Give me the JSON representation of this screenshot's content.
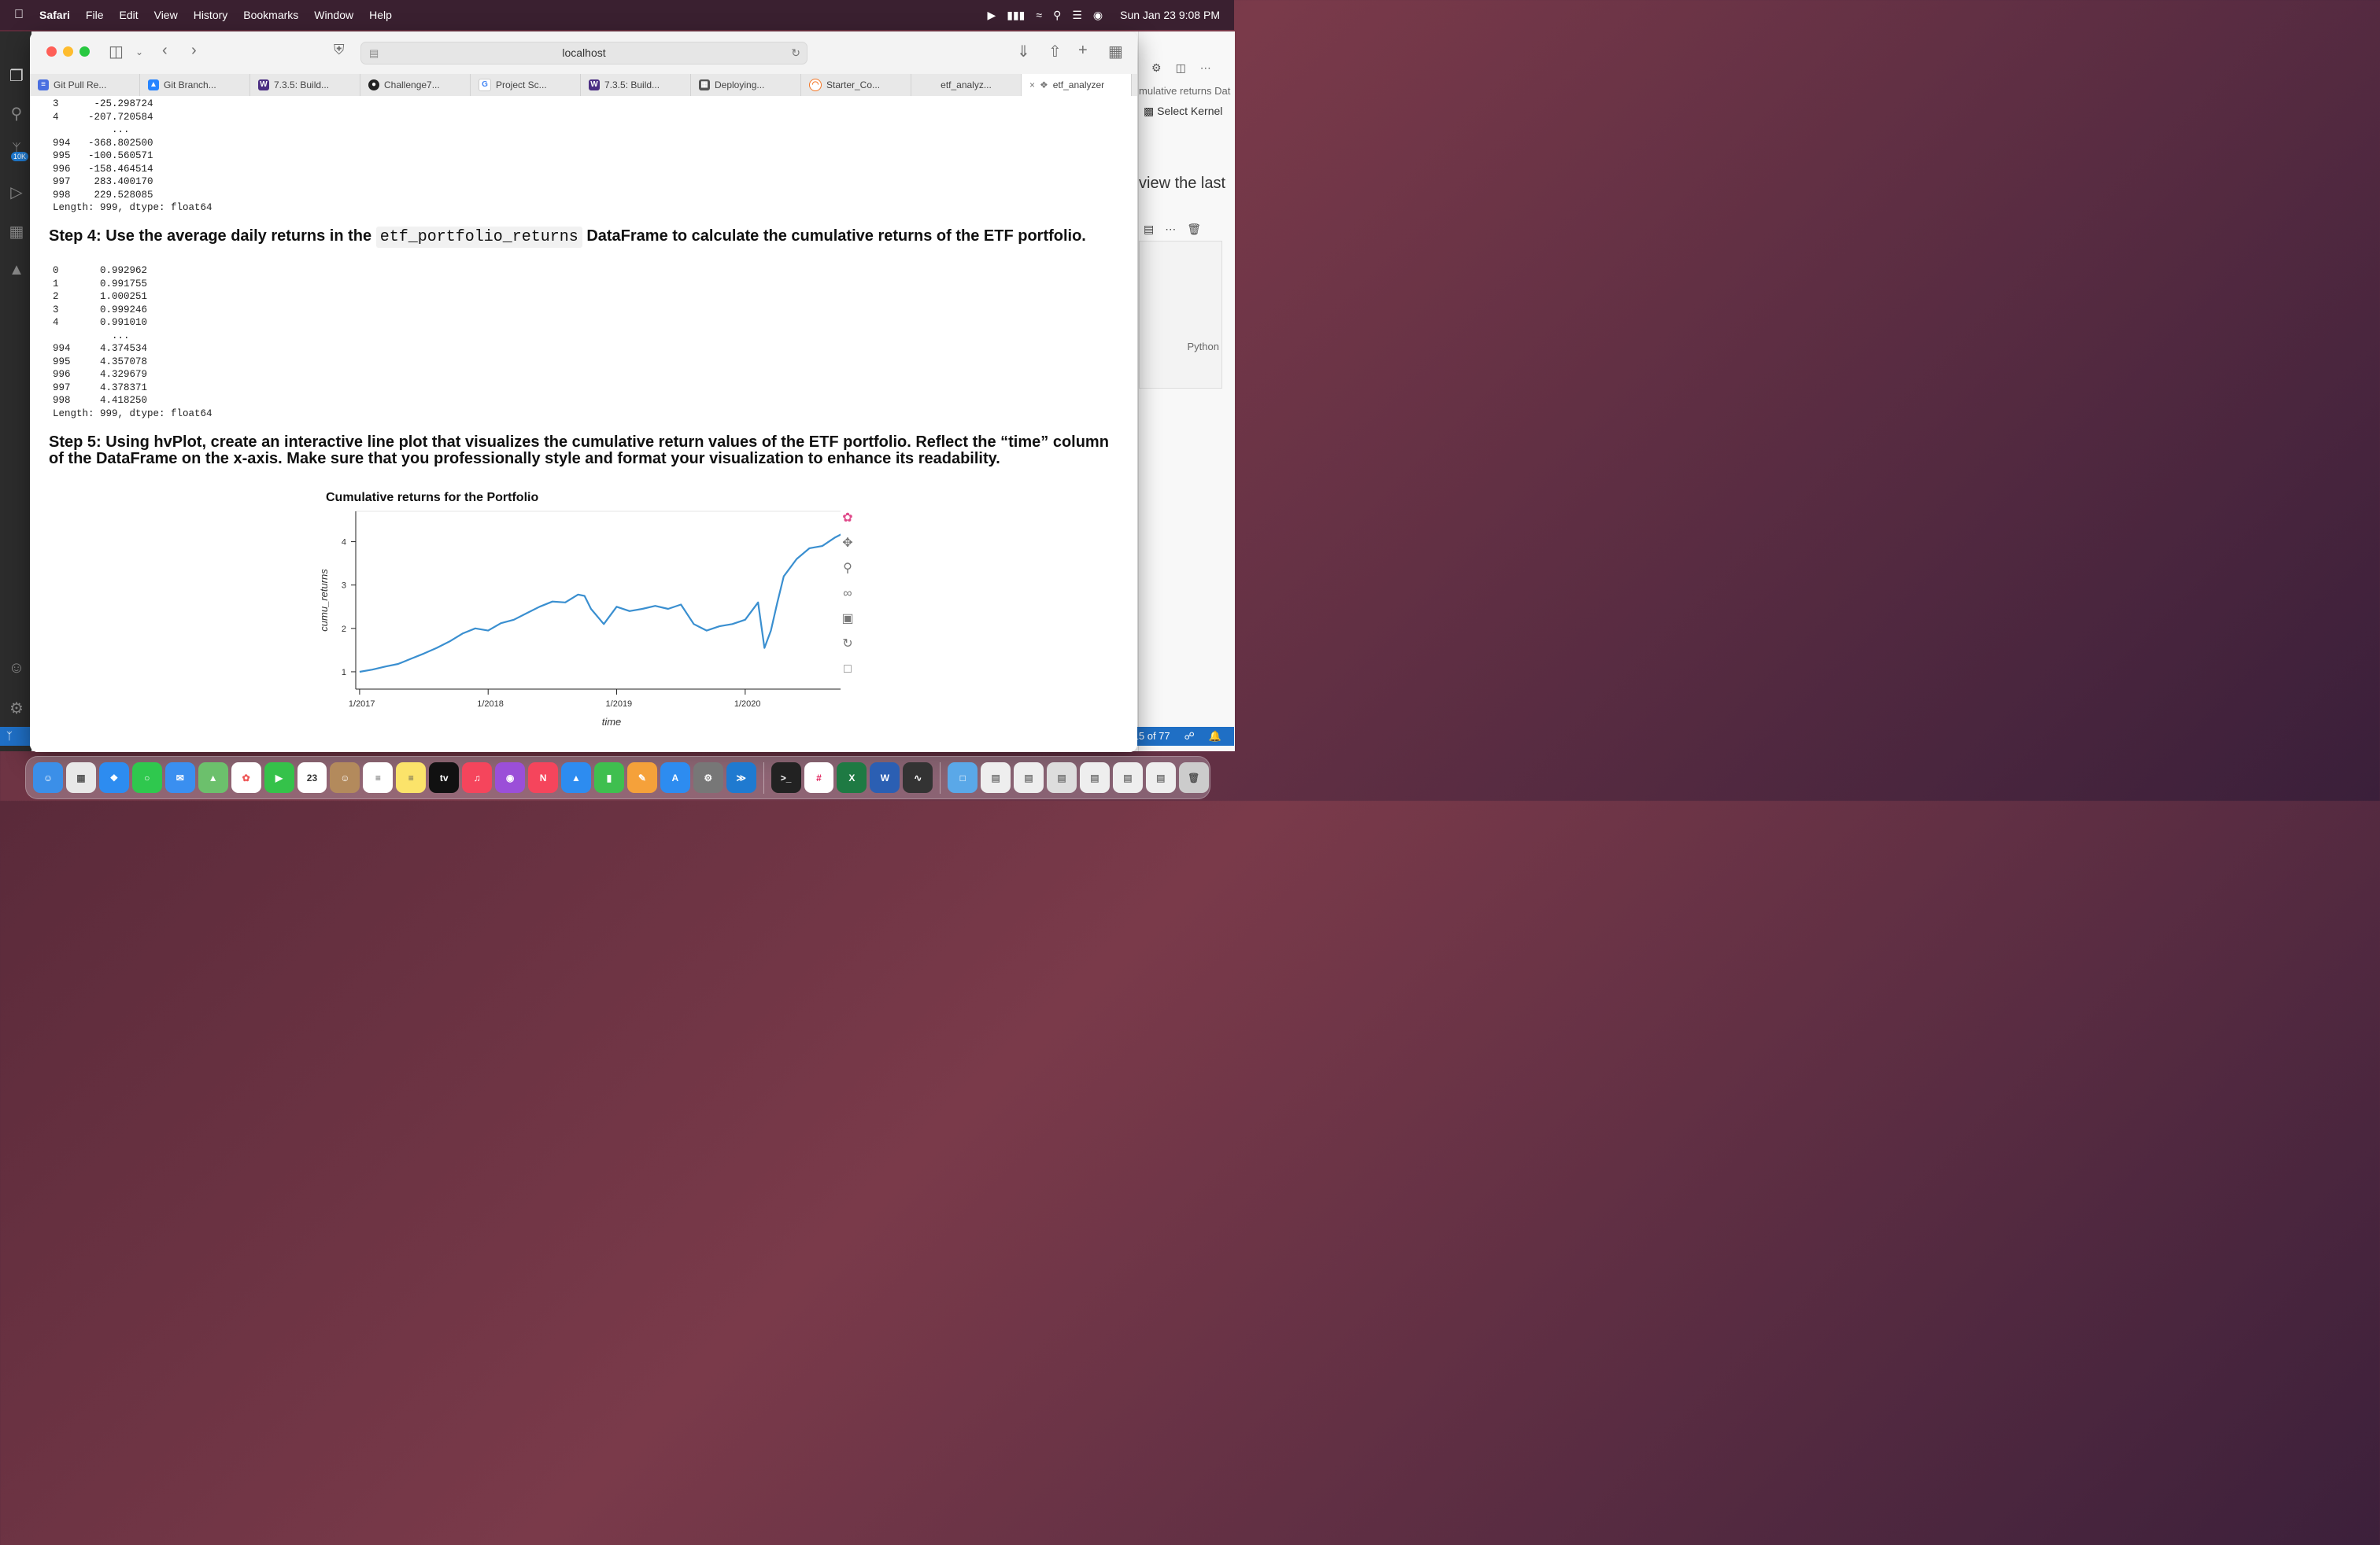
{
  "menubar": {
    "apple": "",
    "app": "Safari",
    "items": [
      "File",
      "Edit",
      "View",
      "History",
      "Bookmarks",
      "Window",
      "Help"
    ],
    "clock": "Sun Jan 23  9:08 PM"
  },
  "safari": {
    "address": "localhost",
    "tabs": [
      {
        "label": "Git Pull Re...",
        "icon": "doc-icon",
        "color": "#4a6fe0"
      },
      {
        "label": "Git Branch...",
        "icon": "atlassian-icon",
        "color": "#2684ff"
      },
      {
        "label": "7.3.5: Build...",
        "icon": "w-icon",
        "color": "#4b2e83"
      },
      {
        "label": "Challenge7...",
        "icon": "github-icon",
        "color": "#222"
      },
      {
        "label": "Project Sc...",
        "icon": "google-icon",
        "color": "#4285f4"
      },
      {
        "label": "7.3.5: Build...",
        "icon": "w-icon",
        "color": "#4b2e83"
      },
      {
        "label": "Deploying...",
        "icon": "board-icon",
        "color": "#555"
      },
      {
        "label": "Starter_Co...",
        "icon": "jupyter-icon",
        "color": "#f37626"
      },
      {
        "label": "etf_analyz...",
        "icon": "none",
        "color": "#888"
      },
      {
        "label": "etf_analyzer",
        "icon": "compass-icon",
        "color": "#888"
      }
    ]
  },
  "notebook": {
    "output1": "3      -25.298724\n4     -207.720584\n          ...\n994   -368.802500\n995   -100.560571\n996   -158.464514\n997    283.400170\n998    229.528085\nLength: 999, dtype: float64",
    "step4_pre": "Step 4: Use the average daily returns in the",
    "step4_code": "etf_portfolio_returns",
    "step4_post": "DataFrame to calculate the cumulative returns of the ETF portfolio.",
    "output2": "0       0.992962\n1       0.991755\n2       1.000251\n3       0.999246\n4       0.991010\n          ...\n994     4.374534\n995     4.357078\n996     4.329679\n997     4.378371\n998     4.418250\nLength: 999, dtype: float64",
    "step5": "Step 5: Using hvPlot, create an interactive line plot that visualizes the cumulative return values of the ETF portfolio. Reflect the “time” column of the DataFrame on the x-axis. Make sure that you professionally style and format your visualization to enhance its readability."
  },
  "chart_data": {
    "type": "line",
    "title": "Cumulative returns for the Portfolio",
    "xlabel": "time",
    "ylabel": "cumu_returns",
    "xticks": [
      "1/2017",
      "1/2018",
      "1/2019",
      "1/2020"
    ],
    "yticks": [
      1,
      2,
      3,
      4
    ],
    "ylim": [
      0.6,
      4.7
    ],
    "x": [
      2017.0,
      2017.1,
      2017.2,
      2017.3,
      2017.4,
      2017.5,
      2017.6,
      2017.7,
      2017.8,
      2017.9,
      2018.0,
      2018.1,
      2018.2,
      2018.3,
      2018.4,
      2018.5,
      2018.6,
      2018.7,
      2018.75,
      2018.8,
      2018.9,
      2019.0,
      2019.1,
      2019.2,
      2019.3,
      2019.4,
      2019.5,
      2019.6,
      2019.7,
      2019.8,
      2019.9,
      2020.0,
      2020.1,
      2020.15,
      2020.2,
      2020.25,
      2020.3,
      2020.4,
      2020.5,
      2020.6,
      2020.7,
      2020.8,
      2020.85,
      2020.9,
      2020.93
    ],
    "values": [
      1.0,
      1.05,
      1.12,
      1.18,
      1.3,
      1.42,
      1.55,
      1.7,
      1.88,
      2.0,
      1.95,
      2.12,
      2.2,
      2.35,
      2.5,
      2.62,
      2.6,
      2.78,
      2.75,
      2.45,
      2.1,
      2.5,
      2.4,
      2.45,
      2.52,
      2.45,
      2.55,
      2.1,
      1.95,
      2.05,
      2.1,
      2.2,
      2.6,
      1.55,
      1.95,
      2.6,
      3.2,
      3.6,
      3.85,
      3.9,
      4.1,
      4.25,
      3.75,
      4.35,
      4.4
    ]
  },
  "vscode": {
    "badge": "10K",
    "panel_tab": "mulative returns Dat",
    "select_kernel": "Select Kernel",
    "view_last": "view the last",
    "python": "Python",
    "status_left": "",
    "status_right": "15 of 77"
  }
}
